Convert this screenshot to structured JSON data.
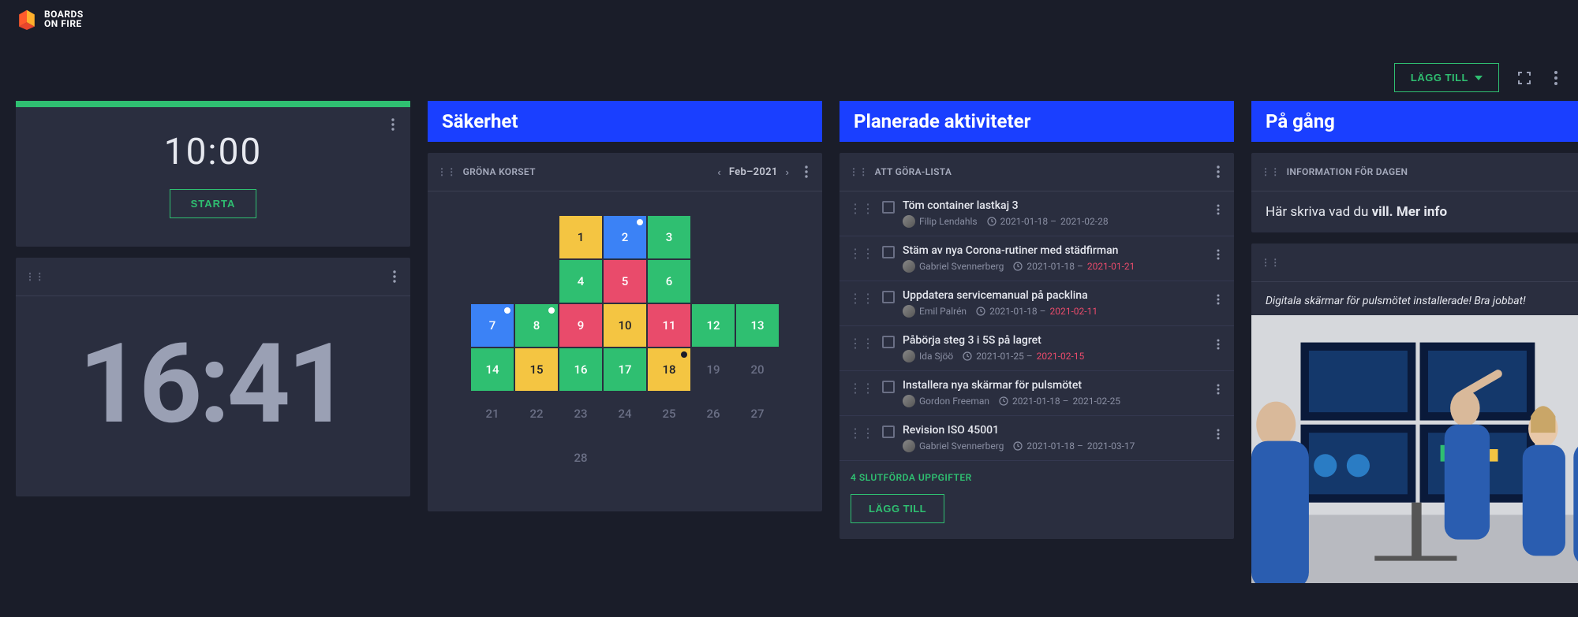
{
  "brand": {
    "line1": "BOARDS",
    "line2": "ON FIRE"
  },
  "topbar": {
    "add_label": "LÄGG TILL"
  },
  "timer": {
    "time": "10:00",
    "start_label": "STARTA"
  },
  "clock": {
    "time": "16:41"
  },
  "sections": {
    "safety": "Säkerhet",
    "planned": "Planerade aktiviteter",
    "ongoing": "På gång"
  },
  "calendar": {
    "title": "GRÖNA KORSET",
    "period": "Feb–2021",
    "rows": [
      [
        null,
        null,
        {
          "n": 1,
          "c": "y"
        },
        {
          "n": 2,
          "c": "b",
          "dot": "w"
        },
        {
          "n": 3,
          "c": "g"
        },
        null,
        null
      ],
      [
        null,
        null,
        {
          "n": 4,
          "c": "g"
        },
        {
          "n": 5,
          "c": "r"
        },
        {
          "n": 6,
          "c": "g"
        },
        null,
        null
      ],
      [
        {
          "n": 7,
          "c": "b",
          "dot": "w"
        },
        {
          "n": 8,
          "c": "g",
          "dot": "w"
        },
        {
          "n": 9,
          "c": "r"
        },
        {
          "n": 10,
          "c": "y"
        },
        {
          "n": 11,
          "c": "r"
        },
        {
          "n": 12,
          "c": "g"
        },
        {
          "n": 13,
          "c": "g"
        }
      ],
      [
        {
          "n": 14,
          "c": "g"
        },
        {
          "n": 15,
          "c": "y"
        },
        {
          "n": 16,
          "c": "g"
        },
        {
          "n": 17,
          "c": "g"
        },
        {
          "n": 18,
          "c": "y",
          "dot": "d"
        },
        {
          "n": 19,
          "c": "d"
        },
        {
          "n": 20,
          "c": "d"
        }
      ],
      [
        {
          "n": 21,
          "c": "d"
        },
        {
          "n": 22,
          "c": "d"
        },
        {
          "n": 23,
          "c": "d"
        },
        {
          "n": 24,
          "c": "d"
        },
        {
          "n": 25,
          "c": "d"
        },
        {
          "n": 26,
          "c": "d"
        },
        {
          "n": 27,
          "c": "d"
        }
      ],
      [
        null,
        null,
        {
          "n": 28,
          "c": "d"
        },
        null,
        null,
        null,
        null
      ]
    ]
  },
  "tasks": {
    "title": "ATT GÖRA-LISTA",
    "add_label": "LÄGG TILL",
    "done_text": "4 SLUTFÖRDA UPPGIFTER",
    "items": [
      {
        "title": "Töm container lastkaj 3",
        "person": "Filip Lendahls",
        "start": "2021-01-18",
        "end": "2021-02-28",
        "overdue": false
      },
      {
        "title": "Stäm av nya Corona-rutiner med städfirman",
        "person": "Gabriel Svennerberg",
        "start": "2021-01-18",
        "end": "2021-01-21",
        "overdue": true
      },
      {
        "title": "Uppdatera servicemanual på packlina",
        "person": "Emil Palrén",
        "start": "2021-01-18",
        "end": "2021-02-11",
        "overdue": true
      },
      {
        "title": "Påbörja steg 3 i 5S på lagret",
        "person": "Ida Sjöö",
        "start": "2021-01-25",
        "end": "2021-02-15",
        "overdue": true
      },
      {
        "title": "Installera nya skärmar för pulsmötet",
        "person": "Gordon Freeman",
        "start": "2021-01-18",
        "end": "2021-02-25",
        "overdue": false
      },
      {
        "title": "Revision ISO 45001",
        "person": "Gabriel Svennerberg",
        "start": "2021-01-18",
        "end": "2021-03-17",
        "overdue": false
      }
    ]
  },
  "info": {
    "title": "INFORMATION FÖR DAGEN",
    "text_pre": "Här skriva vad du ",
    "text_bold": "vill. Mer info"
  },
  "photo": {
    "caption": "Digitala skärmar för pulsmötet installerade! Bra jobbat!"
  }
}
